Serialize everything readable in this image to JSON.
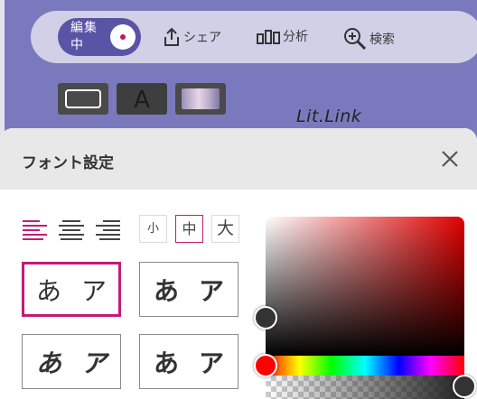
{
  "toolbar": {
    "edit_label": "編集中",
    "share_label": "シェア",
    "analytics_label": "分析",
    "search_label": "検索"
  },
  "logo_text": "Lit.Link",
  "tools": {
    "text_tool_glyph": "A"
  },
  "panel": {
    "title": "フォント設定",
    "size_options": [
      "小",
      "中",
      "大"
    ],
    "selected_size": "中",
    "selected_alignment": "left",
    "font_samples": [
      {
        "chars": [
          "あ",
          "ア"
        ],
        "selected": true
      },
      {
        "chars": [
          "あ",
          "ア"
        ],
        "selected": false
      },
      {
        "chars": [
          "あ",
          "ア"
        ],
        "selected": false
      },
      {
        "chars": [
          "あ",
          "ア"
        ],
        "selected": false
      }
    ]
  },
  "color_picker": {
    "hue_color": "#ff0000",
    "selected_color": "#333333",
    "knob_color_sv": "#333333",
    "knob_color_hue": "#ff0000",
    "knob_color_alpha": "#333333"
  },
  "colors": {
    "accent": "#c21c75",
    "background": "#7b79bd",
    "edit_toggle": "#5954a6"
  }
}
